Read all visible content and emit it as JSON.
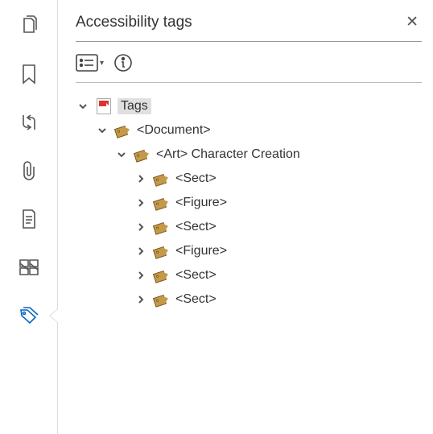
{
  "panel": {
    "title": "Accessibility tags",
    "close": "✕"
  },
  "toolbar": {
    "options_caret": "▾"
  },
  "rail": {
    "items": [
      {
        "name": "pages"
      },
      {
        "name": "bookmarks"
      },
      {
        "name": "reorder"
      },
      {
        "name": "attachments"
      },
      {
        "name": "content"
      },
      {
        "name": "stamps"
      },
      {
        "name": "tags"
      }
    ]
  },
  "tree": {
    "root": {
      "label": "Tags",
      "expanded": true,
      "children": [
        {
          "label": "<Document>",
          "expanded": true,
          "children": [
            {
              "label": "<Art> Character Creation",
              "expanded": true,
              "children": [
                {
                  "label": "<Sect>",
                  "expanded": false
                },
                {
                  "label": "<Figure>",
                  "expanded": false
                },
                {
                  "label": "<Sect>",
                  "expanded": false
                },
                {
                  "label": "<Figure>",
                  "expanded": false
                },
                {
                  "label": "<Sect>",
                  "expanded": false
                },
                {
                  "label": "<Sect>",
                  "expanded": false
                }
              ]
            }
          ]
        }
      ]
    }
  }
}
